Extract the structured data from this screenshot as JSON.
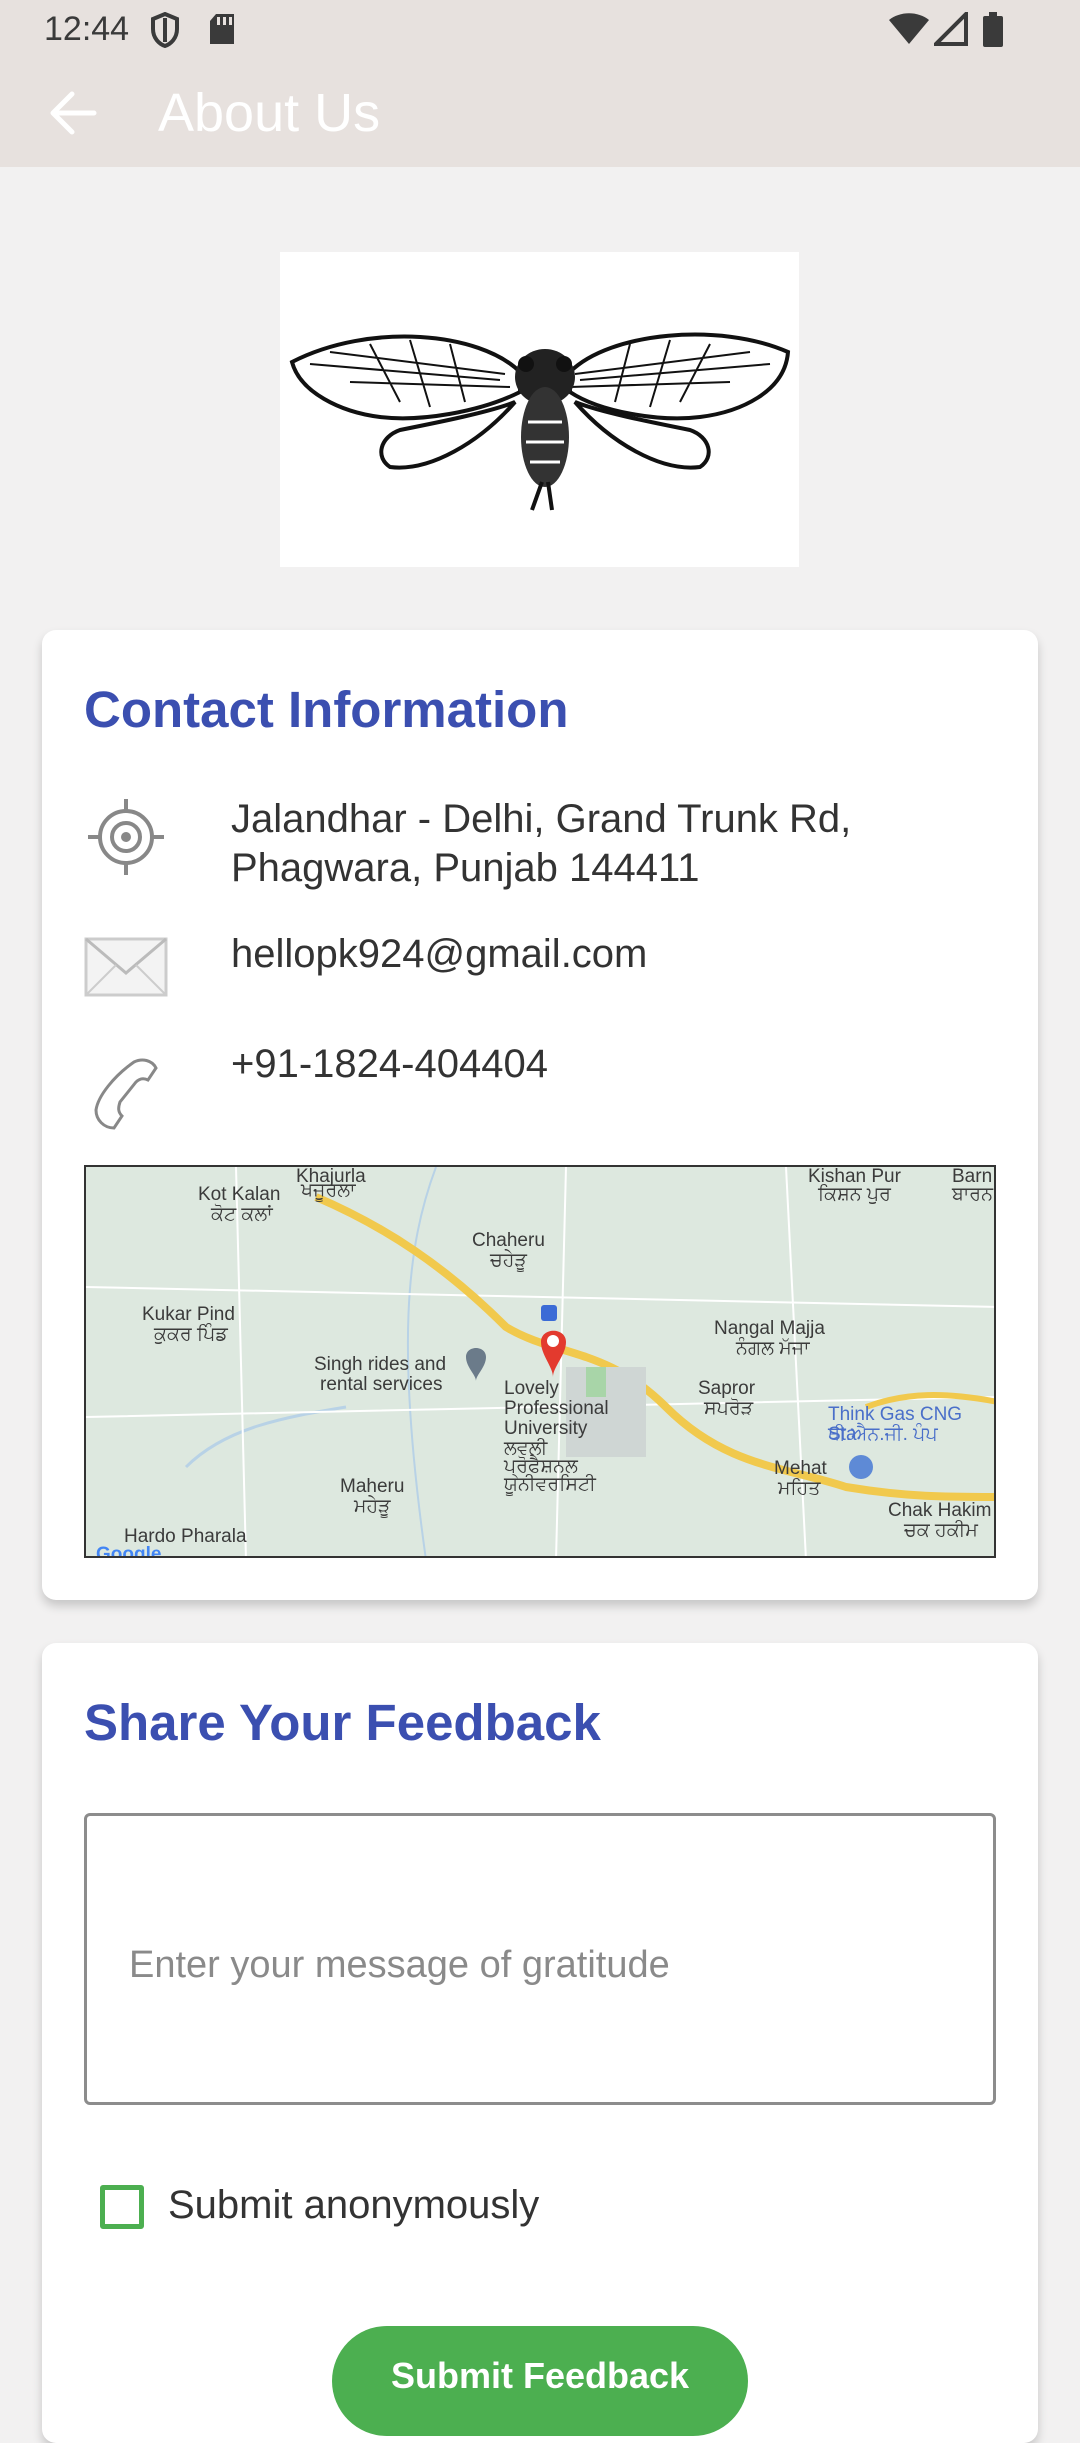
{
  "status_bar": {
    "time": "12:44",
    "icons": [
      "shield-icon",
      "sd-card-icon",
      "wifi-icon",
      "signal-icon",
      "battery-icon"
    ]
  },
  "app_bar": {
    "title": "About Us",
    "back_icon": "arrow-back-icon",
    "background": "#e7e1de"
  },
  "logo": {
    "alt_icon": "cicada-logo"
  },
  "contact": {
    "title": "Contact Information",
    "address_line1": "Jalandhar - Delhi, Grand Trunk Rd,",
    "address_line2": "Phagwara, Punjab 144411",
    "email": "hellopk924@gmail.com",
    "phone": "+91-1824-404404",
    "map_labels": [
      "Khajurla",
      "ਖਜੂਰਲਾ",
      "Kot Kalan",
      "ਕੋਟ ਕਲਾਂ",
      "Kishan Pur",
      "ਕਿਸ਼ਨ ਪੁਰ",
      "Barn",
      "ਬਾਰਨ",
      "Chaheru",
      "ਚਹੇੜੂ",
      "Kukar Pind",
      "ਕੁਕਰ ਪਿੰਡ",
      "Nangal Majja",
      "ਨੰਗਲ ਮੱਜਾ",
      "Singh rides and",
      "rental services",
      "Lovely",
      "Professional",
      "University",
      "ਲਵਲੀ",
      "ਪ੍ਰੋਫੈਸ਼ਨਲ",
      "ਯੂਨੀਵਰਸਿਟੀ",
      "Sapror",
      "ਸਪਰੋੜ",
      "Think Gas CNG Sta",
      "ਥੀ.ਐਨ.ਜੀ. ਪੰਪ",
      "Maheru",
      "ਮਹੇੜੂ",
      "Mehat",
      "ਮਹਿਤ",
      "Chak Hakim",
      "ਚਕ ਹਕੀਮ",
      "Hardo Pharala",
      "Google"
    ]
  },
  "feedback": {
    "title": "Share Your Feedback",
    "placeholder": "Enter your message of gratitude",
    "anonymous_label": "Submit anonymously",
    "submit_label": "Submit Feedback"
  },
  "colors": {
    "accent_title": "#3b4fb0",
    "button_green": "#4caf50",
    "background": "#f2f1f1"
  }
}
